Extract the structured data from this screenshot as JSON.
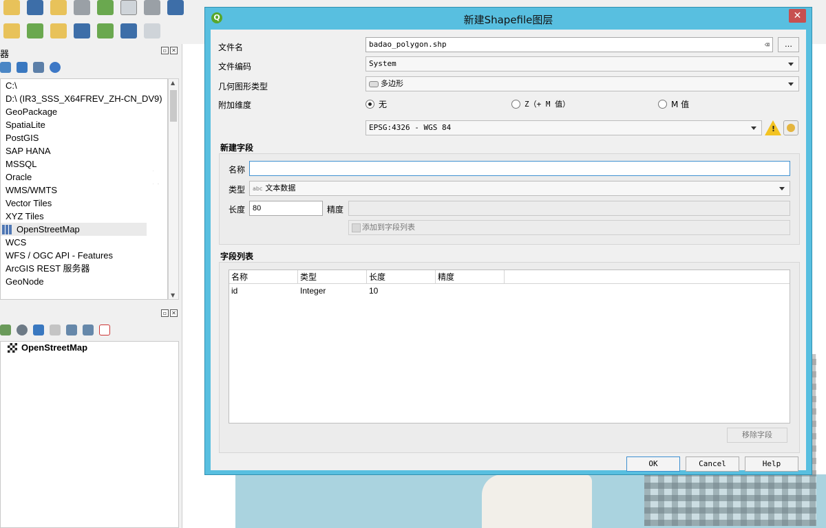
{
  "browser": {
    "title": "器",
    "items": [
      {
        "label": "C:\\"
      },
      {
        "label": "D:\\ (IR3_SSS_X64FREV_ZH-CN_DV9)"
      },
      {
        "label": "GeoPackage"
      },
      {
        "label": "SpatiaLite"
      },
      {
        "label": "PostGIS"
      },
      {
        "label": "SAP HANA"
      },
      {
        "label": "MSSQL"
      },
      {
        "label": "Oracle"
      },
      {
        "label": "WMS/WMTS"
      },
      {
        "label": "Vector Tiles"
      },
      {
        "label": "XYZ Tiles"
      },
      {
        "label": "OpenStreetMap"
      },
      {
        "label": "WCS"
      },
      {
        "label": "WFS / OGC API - Features"
      },
      {
        "label": "ArcGIS REST 服务器"
      },
      {
        "label": "GeoNode"
      }
    ]
  },
  "layers": {
    "item": "OpenStreetMap"
  },
  "dialog": {
    "title": "新建Shapefile图层",
    "close": "✕",
    "file_name_label": "文件名",
    "file_name_value": "badao_polygon.shp",
    "browse_button": "…",
    "encoding_label": "文件编码",
    "encoding_value": "System",
    "geometry_label": "几何图形类型",
    "geometry_value": "多边形",
    "dimension_label": "附加维度",
    "dimension_options": [
      "无",
      "Z（+ M 值）",
      "M 值"
    ],
    "crs_value": "EPSG:4326 - WGS 84",
    "new_field_title": "新建字段",
    "name_label": "名称",
    "name_value": "",
    "type_label": "类型",
    "type_value": "文本数据",
    "length_label": "长度",
    "length_value": "80",
    "precision_label": "精度",
    "add_to_list_button": "添加到字段列表",
    "field_list_title": "字段列表",
    "columns": [
      "名称",
      "类型",
      "长度",
      "精度"
    ],
    "rows": [
      [
        "id",
        "Integer",
        "10",
        ""
      ]
    ],
    "remove_field_button": "移除字段",
    "ok_button": "OK",
    "cancel_button": "Cancel",
    "help_button": "Help"
  }
}
